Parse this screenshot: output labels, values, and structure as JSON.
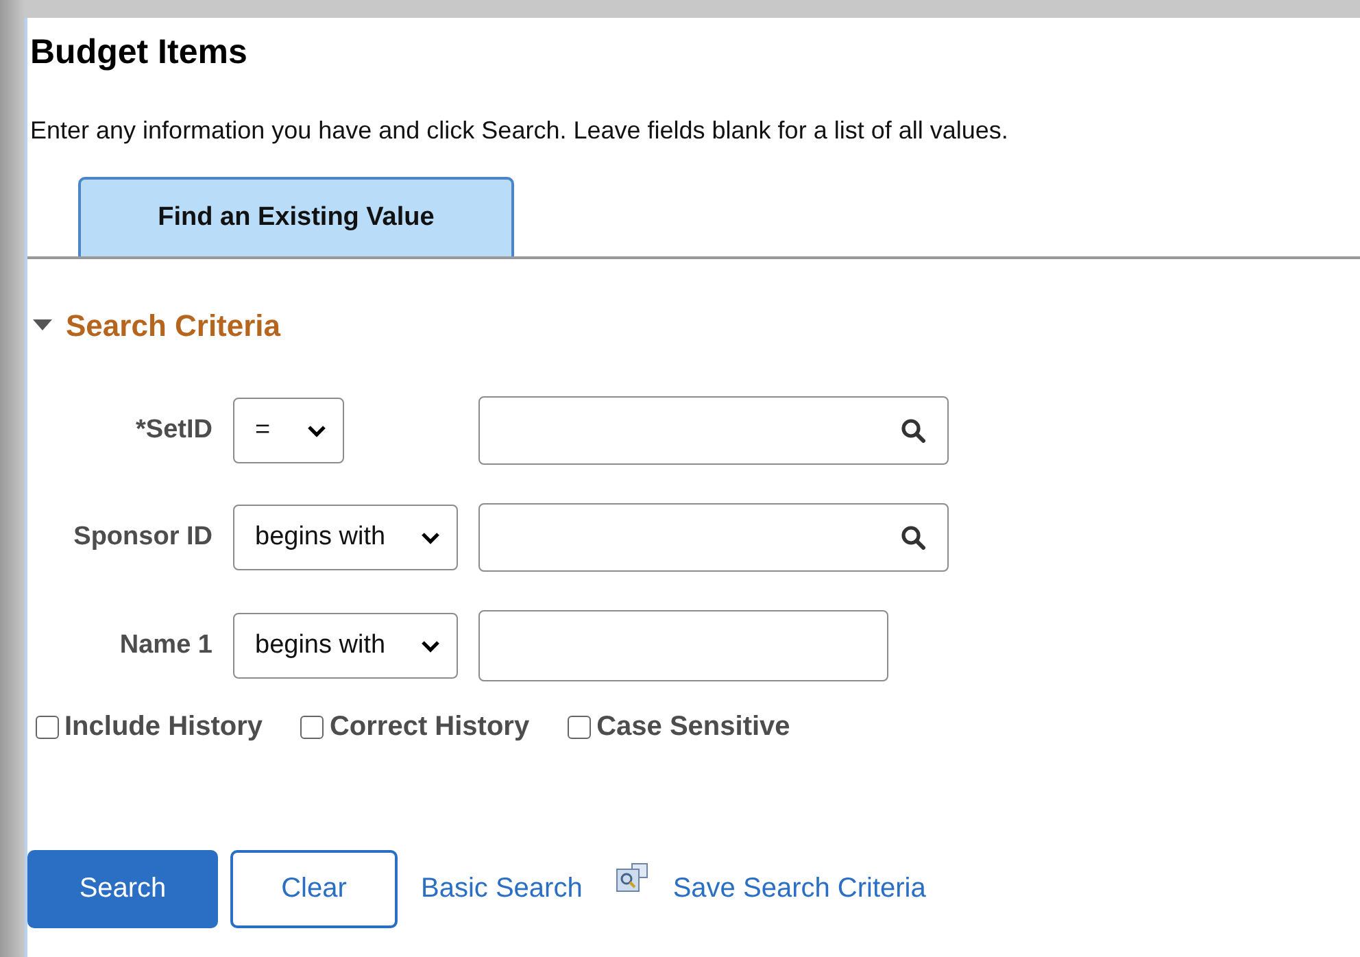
{
  "title": "Budget Items",
  "instructions": "Enter any information you have and click Search. Leave fields blank for a list of all values.",
  "tabs": [
    {
      "label": "Find an Existing Value",
      "selected": true
    }
  ],
  "section": {
    "title": "Search Criteria",
    "expanded": true
  },
  "fields": [
    {
      "label": "*SetID",
      "operator": "=",
      "lookup": true
    },
    {
      "label": "Sponsor ID",
      "operator": "begins with",
      "lookup": true
    },
    {
      "label": "Name 1",
      "operator": "begins with",
      "lookup": false
    }
  ],
  "options": [
    {
      "label": "Include History",
      "checked": false
    },
    {
      "label": "Correct History",
      "checked": false
    },
    {
      "label": "Case Sensitive",
      "checked": false
    }
  ],
  "buttons": [
    {
      "label": "Search",
      "kind": "primary"
    },
    {
      "label": "Clear",
      "kind": "secondary"
    }
  ],
  "links": [
    {
      "label": "Basic Search",
      "kind": "plain"
    },
    {
      "label": "Save Search Criteria",
      "kind": "save"
    }
  ]
}
